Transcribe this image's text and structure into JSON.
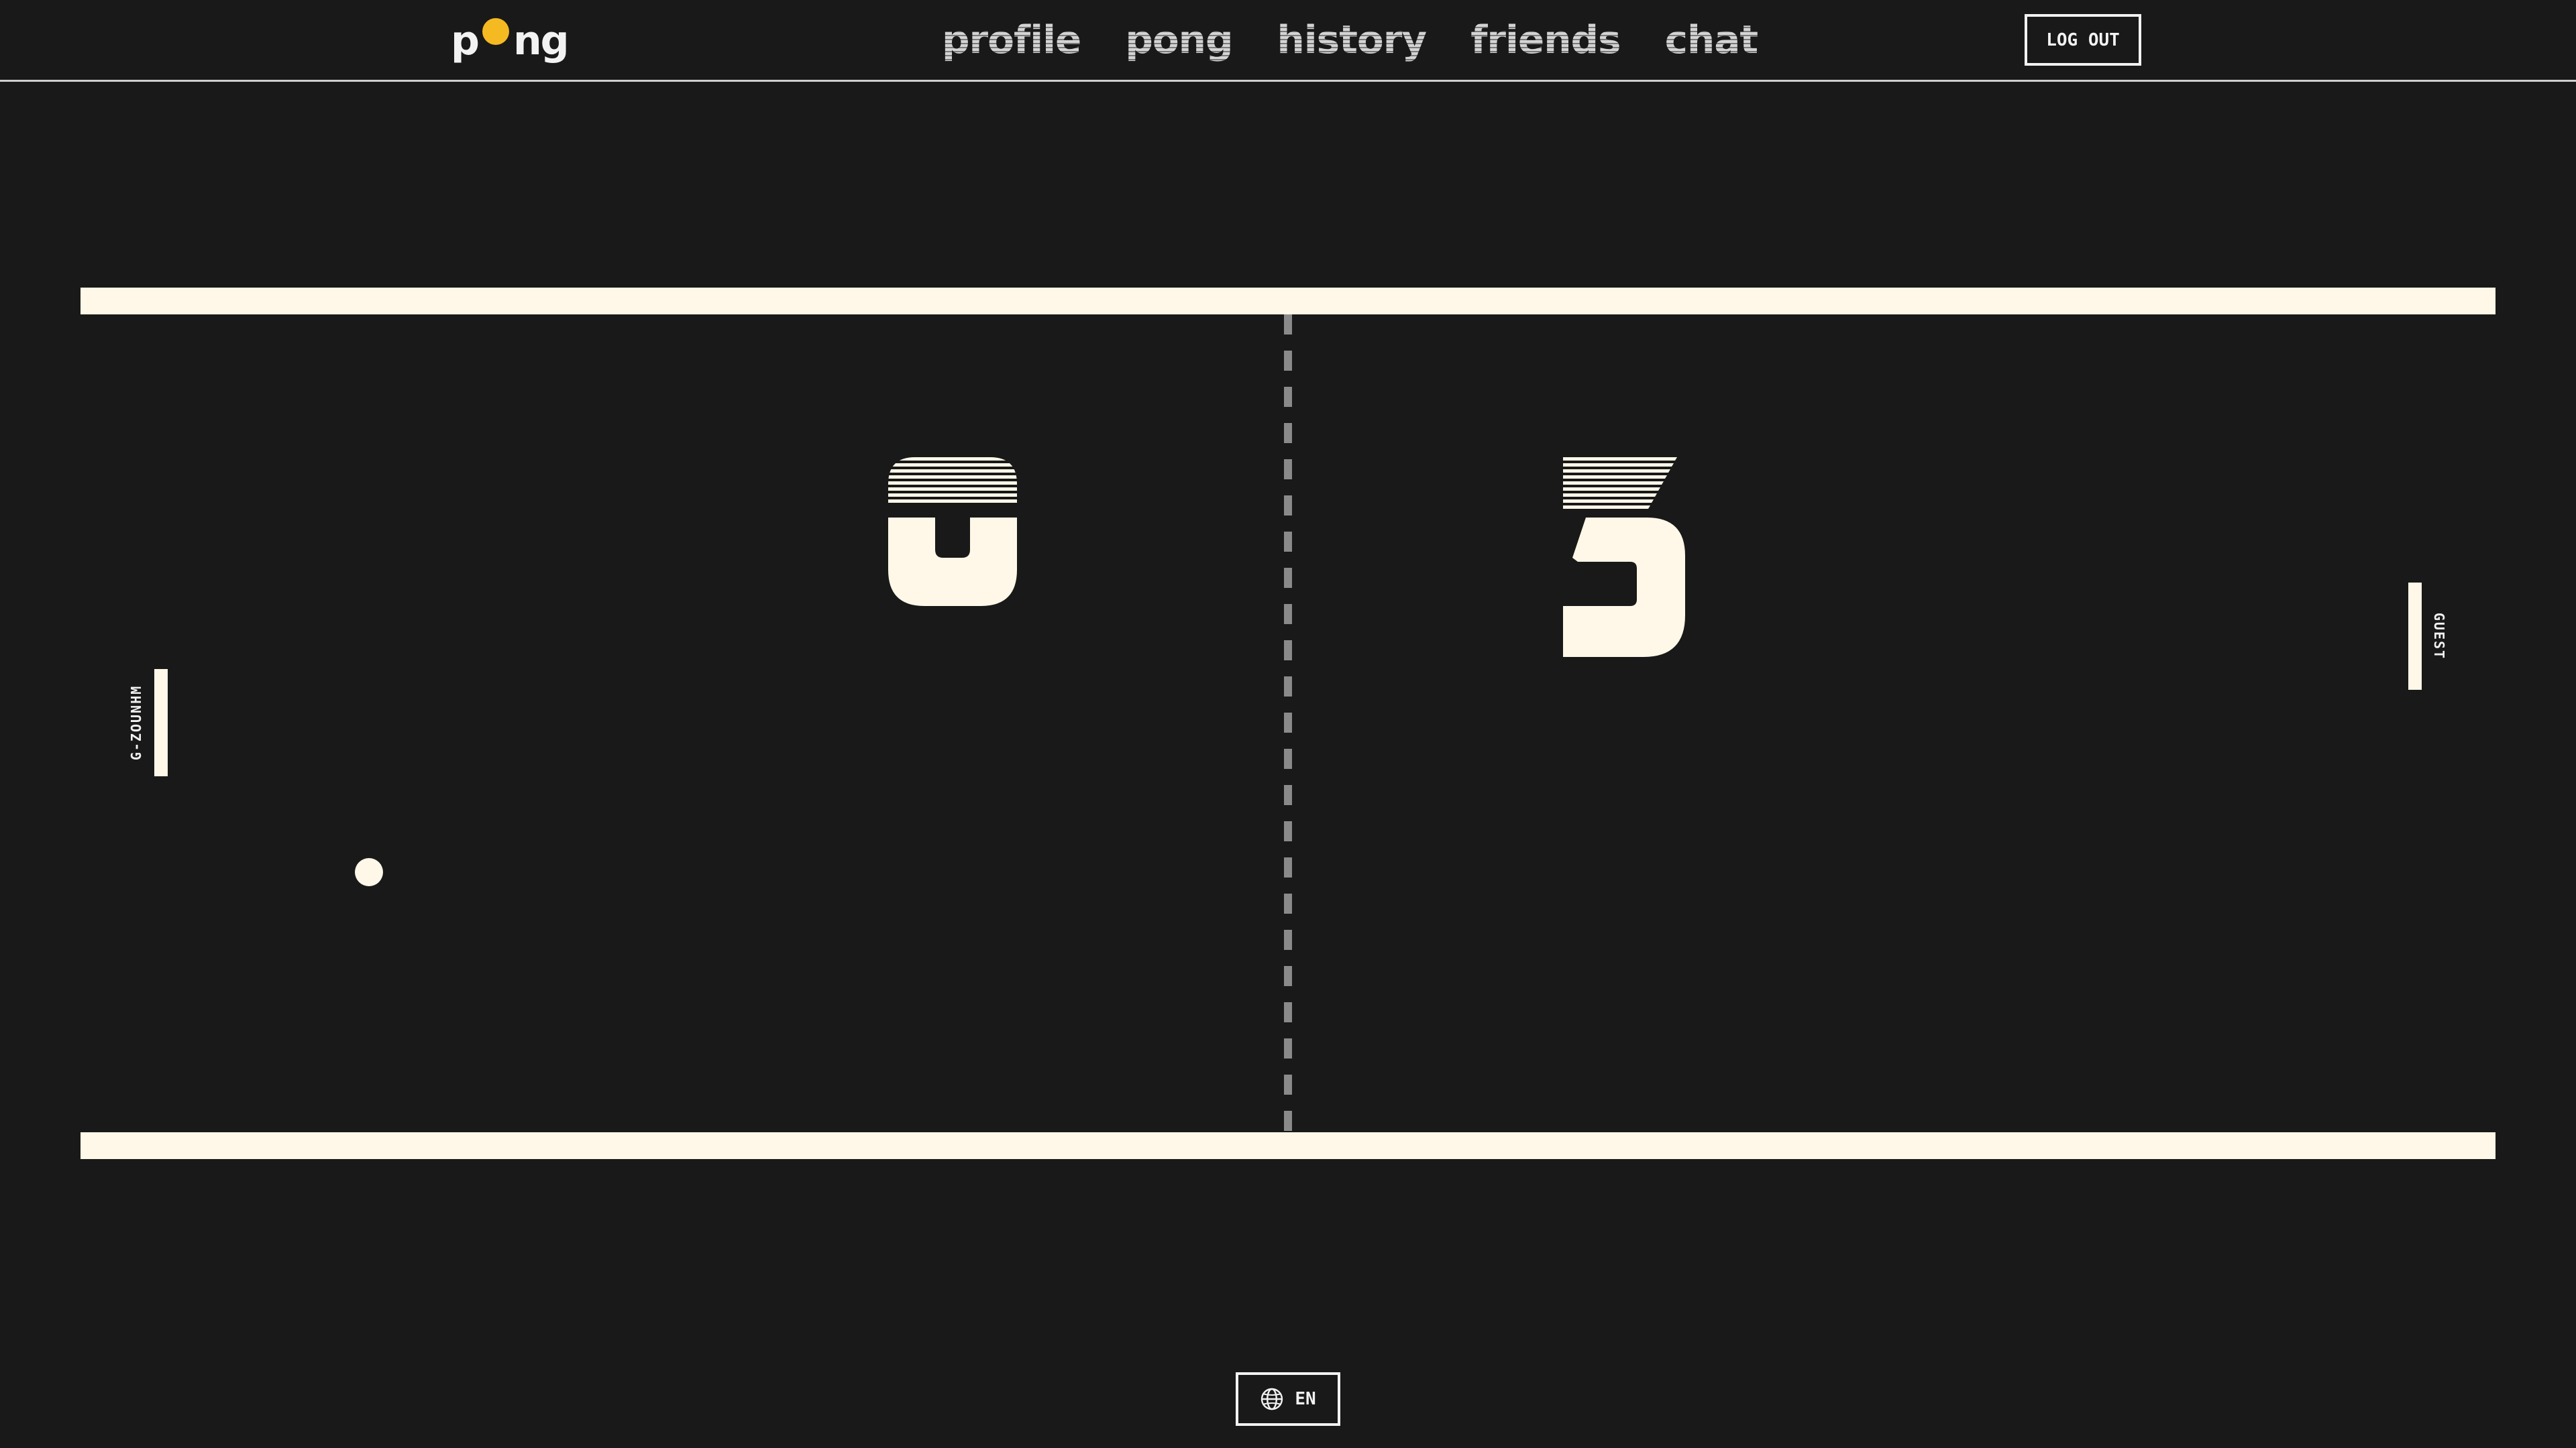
{
  "header": {
    "logo": {
      "text_before": "p",
      "text_after": "ng",
      "ball_color": "#f5b921",
      "icon": "ball-icon"
    },
    "nav": [
      {
        "id": "profile",
        "label": "profile"
      },
      {
        "id": "pong",
        "label": "pong"
      },
      {
        "id": "history",
        "label": "history"
      },
      {
        "id": "friends",
        "label": "friends"
      },
      {
        "id": "chat",
        "label": "chat"
      }
    ],
    "logout_label": "LOG OUT"
  },
  "game": {
    "left_player": {
      "name": "G-ZOUNHM",
      "score": "0"
    },
    "right_player": {
      "name": "GUEST",
      "score": "3"
    },
    "colors": {
      "background": "#191919",
      "field": "#fff8e8",
      "center_line": "#8a8a8a"
    }
  },
  "footer": {
    "language": {
      "label": "EN",
      "icon": "globe-icon"
    }
  }
}
